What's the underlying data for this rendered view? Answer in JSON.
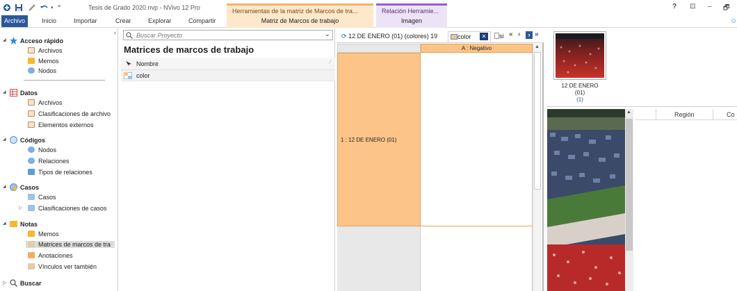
{
  "titlebar": {
    "doc_title": "Tesis de Grado 2020.nvp - NVivo 12 Pro",
    "context_tab_1": "Herramientas de la matriz de Marcos de tra...",
    "context_tab_2": "Relación  Herramie...",
    "help": "?",
    "restore": "⊡",
    "minimize": "–",
    "maximize": "🗗"
  },
  "ribbon": {
    "tabs": [
      "Archivo",
      "Inicio",
      "Importar",
      "Crear",
      "Explorar",
      "Compartir"
    ],
    "context_sub_1": "Matriz de Marcos de trabajo",
    "context_sub_2": "Imagen"
  },
  "nav": {
    "sections": [
      {
        "label": "Acceso rápido",
        "items": [
          "Archivos",
          "Memos",
          "Nodos"
        ]
      },
      {
        "label": "Datos",
        "items": [
          "Archivos",
          "Clasificaciones de archivo",
          "Elementos externos"
        ]
      },
      {
        "label": "Códigos",
        "items": [
          "Nodos",
          "Relaciones",
          "Tipos de relaciones"
        ]
      },
      {
        "label": "Casos",
        "items": [
          "Casos",
          "Clasificaciones de casos"
        ]
      },
      {
        "label": "Notas",
        "items": [
          "Memos",
          "Matrices de marcos de tra",
          "Anotaciones",
          "Vínculos ver también"
        ]
      },
      {
        "label": "Buscar",
        "items": []
      }
    ]
  },
  "list": {
    "search_placeholder": "Buscar Proyecto",
    "title": "Matrices de marcos de trabajo",
    "column_header": "Nombre",
    "rows": [
      "color"
    ]
  },
  "matrix": {
    "doc_tab_1": "12 DE ENERO (01) (colores) 19",
    "doc_tab_2": "color",
    "doc_tab_3": "si",
    "nav_buttons": [
      "«",
      "‹",
      "›",
      "»"
    ],
    "column_header": "A : Negativo",
    "row_header": "1 : 12 DE ENERO (01)"
  },
  "preview": {
    "thumb_label_1": "12 DE ENERO",
    "thumb_label_2": "(01)",
    "thumb_count": "(1)",
    "columns": [
      "Región",
      "Co"
    ]
  }
}
